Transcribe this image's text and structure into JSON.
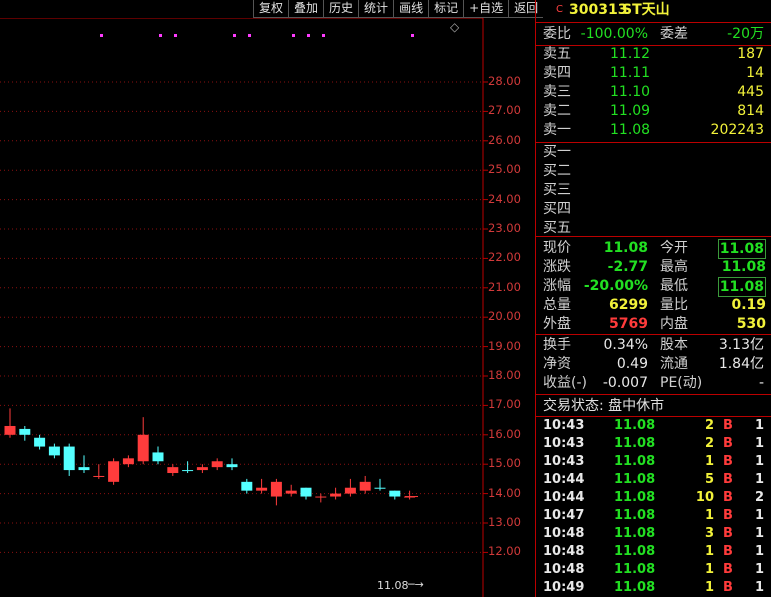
{
  "toolbar": [
    "复权",
    "叠加",
    "历史",
    "统计",
    "画线",
    "标记",
    "+自选",
    "返回"
  ],
  "chart": {
    "y_labels": [
      "28.00",
      "27.00",
      "26.00",
      "25.00",
      "24.00",
      "23.00",
      "22.00",
      "21.00",
      "20.00",
      "19.00",
      "18.00",
      "17.00",
      "16.00",
      "15.00",
      "14.00",
      "13.00",
      "12.00"
    ],
    "price_marker": "11.08",
    "diamond": "◇"
  },
  "chart_data": {
    "type": "candlestick",
    "y_range": [
      11.5,
      28.5
    ],
    "candles": [
      {
        "o": 16.0,
        "c": 16.3,
        "h": 16.9,
        "l": 15.9,
        "up": true
      },
      {
        "o": 16.2,
        "c": 16.0,
        "h": 16.3,
        "l": 15.8,
        "up": false
      },
      {
        "o": 15.9,
        "c": 15.6,
        "h": 16.0,
        "l": 15.5,
        "up": false
      },
      {
        "o": 15.6,
        "c": 15.3,
        "h": 15.7,
        "l": 15.2,
        "up": false
      },
      {
        "o": 15.6,
        "c": 14.8,
        "h": 15.7,
        "l": 14.6,
        "up": false
      },
      {
        "o": 14.9,
        "c": 14.8,
        "h": 15.3,
        "l": 14.7,
        "up": false
      },
      {
        "o": 14.6,
        "c": 14.6,
        "h": 15.0,
        "l": 14.5,
        "up": true
      },
      {
        "o": 14.4,
        "c": 15.1,
        "h": 15.2,
        "l": 14.3,
        "up": true
      },
      {
        "o": 15.0,
        "c": 15.2,
        "h": 15.3,
        "l": 14.9,
        "up": true
      },
      {
        "o": 15.1,
        "c": 16.0,
        "h": 16.6,
        "l": 15.0,
        "up": true
      },
      {
        "o": 15.4,
        "c": 15.1,
        "h": 15.6,
        "l": 15.0,
        "up": false
      },
      {
        "o": 14.7,
        "c": 14.9,
        "h": 15.0,
        "l": 14.6,
        "up": true
      },
      {
        "o": 14.8,
        "c": 14.8,
        "h": 15.1,
        "l": 14.7,
        "up": false
      },
      {
        "o": 14.8,
        "c": 14.9,
        "h": 15.0,
        "l": 14.7,
        "up": true
      },
      {
        "o": 14.9,
        "c": 15.1,
        "h": 15.2,
        "l": 14.8,
        "up": true
      },
      {
        "o": 15.0,
        "c": 14.9,
        "h": 15.2,
        "l": 14.8,
        "up": false
      },
      {
        "o": 14.4,
        "c": 14.1,
        "h": 14.5,
        "l": 14.0,
        "up": false
      },
      {
        "o": 14.1,
        "c": 14.2,
        "h": 14.5,
        "l": 14.0,
        "up": true
      },
      {
        "o": 13.9,
        "c": 14.4,
        "h": 14.5,
        "l": 13.6,
        "up": true
      },
      {
        "o": 14.0,
        "c": 14.1,
        "h": 14.3,
        "l": 13.9,
        "up": true
      },
      {
        "o": 14.2,
        "c": 13.9,
        "h": 14.2,
        "l": 13.8,
        "up": false
      },
      {
        "o": 13.9,
        "c": 13.9,
        "h": 14.0,
        "l": 13.7,
        "up": true
      },
      {
        "o": 13.9,
        "c": 14.0,
        "h": 14.2,
        "l": 13.8,
        "up": true
      },
      {
        "o": 14.0,
        "c": 14.2,
        "h": 14.5,
        "l": 13.9,
        "up": true
      },
      {
        "o": 14.1,
        "c": 14.4,
        "h": 14.6,
        "l": 14.0,
        "up": true
      },
      {
        "o": 14.2,
        "c": 14.2,
        "h": 14.5,
        "l": 14.1,
        "up": false
      },
      {
        "o": 14.1,
        "c": 13.9,
        "h": 14.1,
        "l": 13.8,
        "up": false
      },
      {
        "o": 13.9,
        "c": 13.9,
        "h": 14.1,
        "l": 13.8,
        "up": true
      }
    ]
  },
  "stock": {
    "code": "300313",
    "name": "ST天山",
    "badge": "C"
  },
  "weibi": {
    "label": "委比",
    "value": "-100.00%",
    "label2": "委差",
    "value2": "-20万"
  },
  "asks": [
    {
      "label": "卖五",
      "price": "11.12",
      "vol": "187"
    },
    {
      "label": "卖四",
      "price": "11.11",
      "vol": "14"
    },
    {
      "label": "卖三",
      "price": "11.10",
      "vol": "445"
    },
    {
      "label": "卖二",
      "price": "11.09",
      "vol": "814"
    },
    {
      "label": "卖一",
      "price": "11.08",
      "vol": "202243"
    }
  ],
  "bids": [
    {
      "label": "买一"
    },
    {
      "label": "买二"
    },
    {
      "label": "买三"
    },
    {
      "label": "买四"
    },
    {
      "label": "买五"
    }
  ],
  "quote": [
    {
      "l1": "现价",
      "v1": "11.08",
      "l2": "今开",
      "v2": "11.08"
    },
    {
      "l1": "涨跌",
      "v1": "-2.77",
      "l2": "最高",
      "v2": "11.08"
    },
    {
      "l1": "涨幅",
      "v1": "-20.00%",
      "l2": "最低",
      "v2": "11.08"
    },
    {
      "l1": "总量",
      "v1": "6299",
      "l2": "量比",
      "v2": "0.19"
    },
    {
      "l1": "外盘",
      "v1": "5769",
      "l2": "内盘",
      "v2": "530"
    }
  ],
  "fin": [
    {
      "l1": "换手",
      "v1": "0.34%",
      "l2": "股本",
      "v2": "3.13亿"
    },
    {
      "l1": "净资",
      "v1": "0.49",
      "l2": "流通",
      "v2": "1.84亿"
    },
    {
      "l1": "收益(-)",
      "v1": "-0.007",
      "l2": "PE(动)",
      "v2": "-"
    }
  ],
  "trade_status": "交易状态: 盘中休市",
  "ticks": [
    {
      "t": "10:43",
      "p": "11.08",
      "v": "2",
      "bs": "B",
      "n": "1"
    },
    {
      "t": "10:43",
      "p": "11.08",
      "v": "2",
      "bs": "B",
      "n": "1"
    },
    {
      "t": "10:43",
      "p": "11.08",
      "v": "1",
      "bs": "B",
      "n": "1"
    },
    {
      "t": "10:44",
      "p": "11.08",
      "v": "5",
      "bs": "B",
      "n": "1"
    },
    {
      "t": "10:44",
      "p": "11.08",
      "v": "10",
      "bs": "B",
      "n": "2"
    },
    {
      "t": "10:47",
      "p": "11.08",
      "v": "1",
      "bs": "B",
      "n": "1"
    },
    {
      "t": "10:48",
      "p": "11.08",
      "v": "3",
      "bs": "B",
      "n": "1"
    },
    {
      "t": "10:48",
      "p": "11.08",
      "v": "1",
      "bs": "B",
      "n": "1"
    },
    {
      "t": "10:48",
      "p": "11.08",
      "v": "1",
      "bs": "B",
      "n": "1"
    },
    {
      "t": "10:49",
      "p": "11.08",
      "v": "1",
      "bs": "B",
      "n": "1"
    }
  ]
}
